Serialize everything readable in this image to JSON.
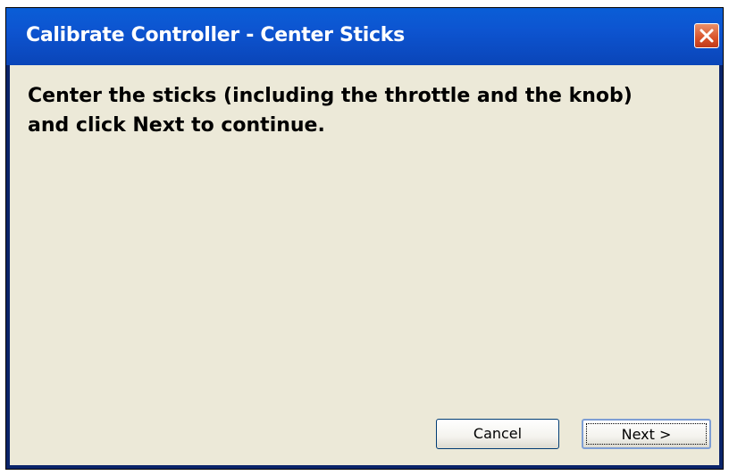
{
  "window": {
    "title": "Calibrate Controller - Center Sticks",
    "close_icon": "close-icon"
  },
  "content": {
    "message": "Center the sticks (including the throttle and the knob) and click Next to continue."
  },
  "buttons": {
    "cancel_label": "Cancel",
    "next_label": "Next >"
  },
  "colors": {
    "titlebar": "#0a5ed7",
    "client_background": "#ece9d8",
    "close_button": "#d9532a"
  }
}
